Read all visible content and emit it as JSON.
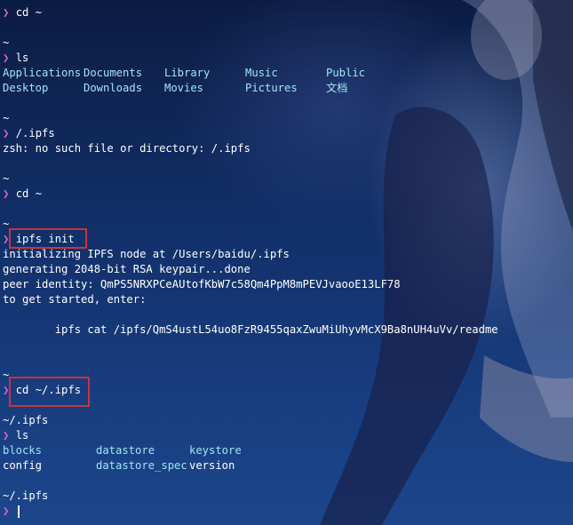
{
  "prompt_symbol": "❯",
  "lines": [
    {
      "type": "cmd",
      "text": "cd ~"
    },
    {
      "type": "blank"
    },
    {
      "type": "path",
      "text": "~"
    },
    {
      "type": "cmd",
      "text": "ls"
    },
    {
      "type": "ls",
      "row": [
        "Applications",
        "Documents",
        "Library",
        "Music",
        "Public"
      ]
    },
    {
      "type": "ls",
      "row": [
        "Desktop",
        "Downloads",
        "Movies",
        "Pictures",
        "文档"
      ]
    },
    {
      "type": "blank"
    },
    {
      "type": "path",
      "text": "~"
    },
    {
      "type": "cmd",
      "text": "/.ipfs"
    },
    {
      "type": "out",
      "text": "zsh: no such file or directory: /.ipfs"
    },
    {
      "type": "blank"
    },
    {
      "type": "path",
      "text": "~"
    },
    {
      "type": "cmd",
      "text": "cd ~"
    },
    {
      "type": "blank"
    },
    {
      "type": "path",
      "text": "~"
    },
    {
      "type": "cmd",
      "text": "ipfs init"
    },
    {
      "type": "out",
      "text": "initializing IPFS node at /Users/baidu/.ipfs"
    },
    {
      "type": "out",
      "text": "generating 2048-bit RSA keypair...done"
    },
    {
      "type": "out",
      "text": "peer identity: QmPS5NRXPCeAUtofKbW7c58Qm4PpM8mPEVJvaooE13LF78"
    },
    {
      "type": "out",
      "text": "to get started, enter:"
    },
    {
      "type": "blank"
    },
    {
      "type": "out",
      "text": "        ipfs cat /ipfs/QmS4ustL54uo8FzR9455qaxZwuMiUhyvMcX9Ba8nUH4uVv/readme"
    },
    {
      "type": "blank"
    },
    {
      "type": "blank"
    },
    {
      "type": "path",
      "text": "~"
    },
    {
      "type": "cmd",
      "text": "cd ~/.ipfs"
    },
    {
      "type": "blank"
    },
    {
      "type": "path",
      "text": "~/.ipfs"
    },
    {
      "type": "cmd",
      "text": "ls"
    },
    {
      "type": "ls2",
      "row": [
        "blocks",
        "datastore",
        "keystore"
      ]
    },
    {
      "type": "ls2",
      "row": [
        "config",
        "datastore_spec",
        "version"
      ]
    },
    {
      "type": "blank"
    },
    {
      "type": "path",
      "text": "~/.ipfs"
    },
    {
      "type": "cursor"
    }
  ],
  "highlight_color": "#c8343a"
}
